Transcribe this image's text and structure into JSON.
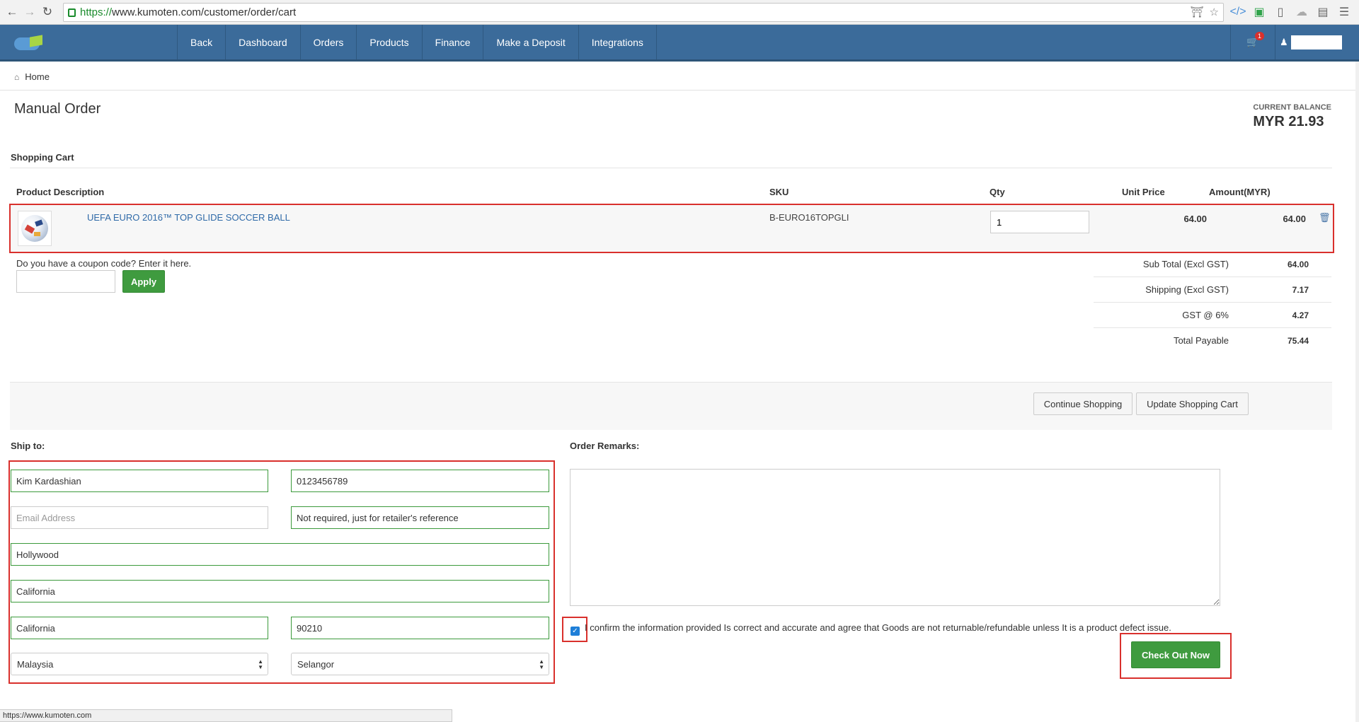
{
  "browser": {
    "url_scheme": "https://",
    "url_host": "www.kumoten.com",
    "url_path": "/customer/order/cart",
    "status_url": "https://www.kumoten.com"
  },
  "nav": {
    "items": [
      "Back",
      "Dashboard",
      "Orders",
      "Products",
      "Finance",
      "Make a Deposit",
      "Integrations"
    ],
    "cart_badge": "1"
  },
  "breadcrumb": {
    "home": "Home"
  },
  "page": {
    "title": "Manual Order",
    "balance_label": "CURRENT BALANCE",
    "balance_value": "MYR 21.93"
  },
  "cart": {
    "heading": "Shopping Cart",
    "headers": {
      "description": "Product Description",
      "sku": "SKU",
      "qty": "Qty",
      "unit_price": "Unit Price",
      "amount": "Amount(MYR)"
    },
    "row": {
      "name": "UEFA EURO 2016™ TOP GLIDE SOCCER BALL",
      "sku": "B-EURO16TOPGLI",
      "qty": "1",
      "unit_price": "64.00",
      "amount": "64.00"
    },
    "coupon_label": "Do you have a coupon code? Enter it here.",
    "apply_label": "Apply",
    "totals": [
      {
        "label": "Sub Total (Excl GST)",
        "value": "64.00"
      },
      {
        "label": "Shipping (Excl GST)",
        "value": "7.17"
      },
      {
        "label": "GST @ 6%",
        "value": "4.27"
      },
      {
        "label": "Total Payable",
        "value": "75.44"
      }
    ],
    "continue_label": "Continue Shopping",
    "update_label": "Update Shopping Cart"
  },
  "ship": {
    "heading": "Ship to:",
    "name": "Kim Kardashian",
    "phone": "0123456789",
    "email_placeholder": "Email Address",
    "reference": "Not required, just for retailer's reference",
    "address1": "Hollywood",
    "address2": "California",
    "city": "California",
    "postcode": "90210",
    "country": "Malaysia",
    "state": "Selangor"
  },
  "remarks": {
    "heading": "Order Remarks:",
    "confirm_text": "I confirm the information provided Is correct and accurate and agree that Goods are not returnable/refundable unless It is a product defect issue.",
    "checkout_label": "Check Out Now"
  }
}
